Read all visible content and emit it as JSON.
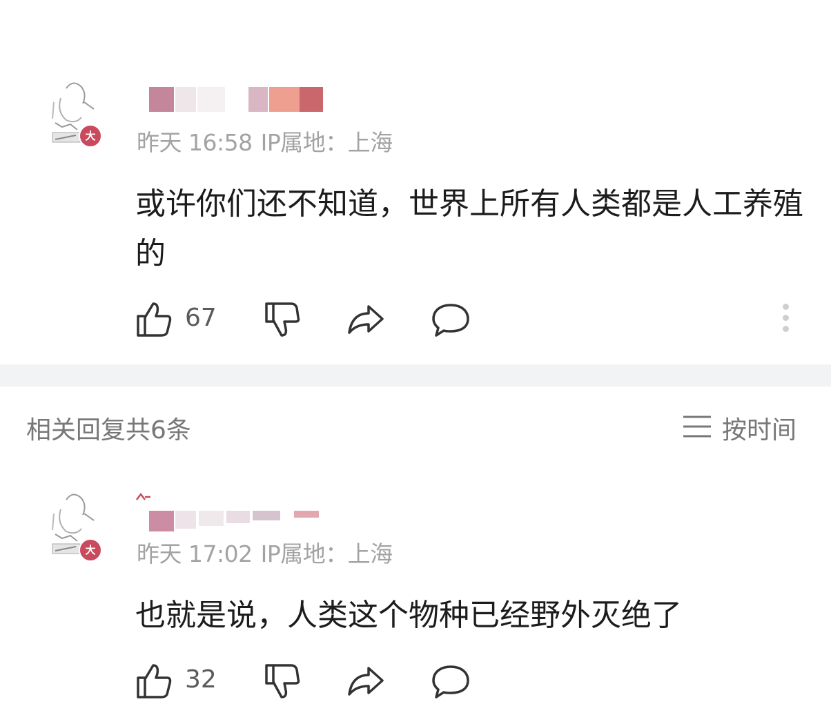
{
  "comments": [
    {
      "time": "昨天 16:58",
      "ip": "IP属地：上海",
      "text": "或许你们还不知道，世界上所有人类都是人工养殖的",
      "likes": "67",
      "badge": "大"
    },
    {
      "time": "昨天 17:02",
      "ip": "IP属地：上海",
      "text": "也就是说，人类这个物种已经野外灭绝了",
      "likes": "32",
      "badge": "大"
    }
  ],
  "replies": {
    "count_label": "相关回复共6条",
    "sort_label": "按时间"
  },
  "icons": {
    "like": "thumbs-up-icon",
    "dislike": "thumbs-down-icon",
    "share": "share-icon",
    "comment": "comment-icon",
    "more": "more-vertical-icon",
    "sort": "list-sort-icon"
  },
  "colors": {
    "badge": "#c94a5d",
    "meta": "#a3a3a3",
    "divider": "#f2f3f5"
  }
}
